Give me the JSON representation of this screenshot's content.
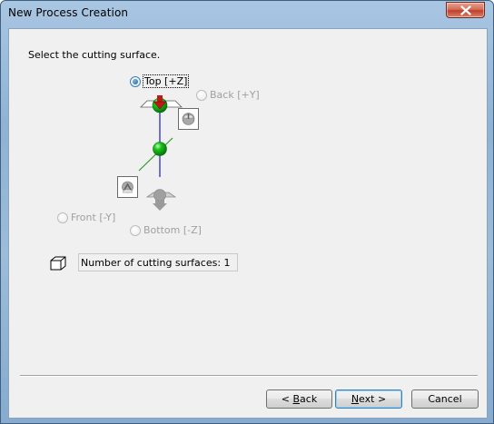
{
  "window": {
    "title": "New Process Creation"
  },
  "dialog": {
    "instruction": "Select the cutting surface.",
    "surfaces": [
      {
        "label": "Top [+Z]",
        "selected": true,
        "enabled": true
      },
      {
        "label": "Back [+Y]",
        "selected": false,
        "enabled": false
      },
      {
        "label": "Front [-Y]",
        "selected": false,
        "enabled": false
      },
      {
        "label": "Bottom [-Z]",
        "selected": false,
        "enabled": false
      }
    ],
    "cutting_surfaces_text": "Number of cutting surfaces: 1"
  },
  "buttons": {
    "back": {
      "prefix": "< ",
      "mnemonic": "B",
      "rest": "ack"
    },
    "next": {
      "mnemonic": "N",
      "rest": "ext >"
    },
    "cancel": "Cancel"
  },
  "icons": {
    "close": "close-icon",
    "sphere": "green-sphere-icon",
    "arrow": "red-arrow-icon",
    "cube": "cube-icon"
  },
  "colors": {
    "sphere": "#17c41a",
    "axis_z": "#1a1ad0",
    "axis_y": "#2a9a2a",
    "arrow": "#c01818"
  }
}
